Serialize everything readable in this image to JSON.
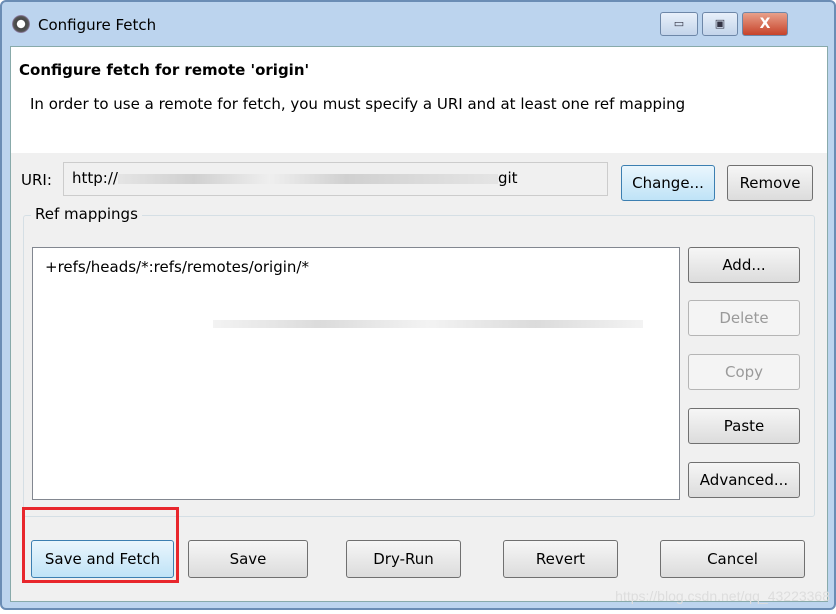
{
  "window": {
    "title": "Configure Fetch",
    "minimize": "▭",
    "maximize": "▣",
    "close": "X"
  },
  "header": {
    "title": "Configure fetch for remote 'origin'",
    "description": "In order to use a remote for fetch, you must specify a URI and at least one ref mapping"
  },
  "uri": {
    "label": "URI:",
    "value_prefix": "http://",
    "value_suffix": "git",
    "change": "Change...",
    "remove": "Remove"
  },
  "ref_mappings": {
    "label": "Ref mappings",
    "items": [
      "+refs/heads/*:refs/remotes/origin/*"
    ],
    "buttons": {
      "add": "Add...",
      "delete": "Delete",
      "copy": "Copy",
      "paste": "Paste",
      "advanced": "Advanced..."
    }
  },
  "footer": {
    "save_and_fetch": "Save and Fetch",
    "save": "Save",
    "dry_run": "Dry-Run",
    "revert": "Revert",
    "cancel": "Cancel"
  },
  "watermark": "https://blog.csdn.net/qq_43223368",
  "colors": {
    "highlight": "#e8262c",
    "focus": "#3c7fb1"
  }
}
